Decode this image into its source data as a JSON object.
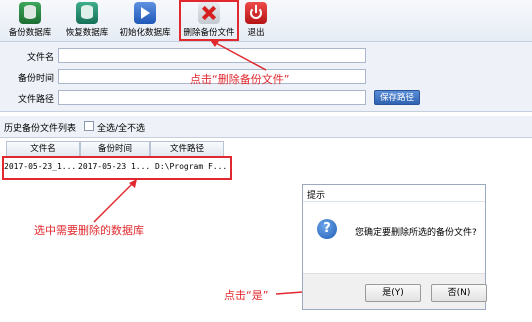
{
  "toolbar": {
    "items": [
      {
        "label": "备份数据库",
        "icon": "backup-db-icon"
      },
      {
        "label": "恢复数据库",
        "icon": "restore-db-icon"
      },
      {
        "label": "初始化数据库",
        "icon": "init-db-icon"
      },
      {
        "label": "删除备份文件",
        "icon": "delete-backup-icon"
      },
      {
        "label": "退出",
        "icon": "power-icon"
      }
    ]
  },
  "form": {
    "file_name_label": "文件名",
    "backup_time_label": "备份时间",
    "file_path_label": "文件路径",
    "save_path_button": "保存路径"
  },
  "history": {
    "title": "历史备份文件列表",
    "select_all_label": "全选/全不选",
    "columns": [
      "文件名",
      "备份时间",
      "文件路径"
    ],
    "rows": [
      {
        "name": "2017-05-23_1...",
        "time": "2017-05-23 1...",
        "path": "D:\\Program F..."
      }
    ]
  },
  "annotations": {
    "click_delete": "点击“删除备份文件”",
    "select_db": "选中需要删除的数据库",
    "click_yes": "点击“是”"
  },
  "dialog": {
    "title": "提示",
    "message": "您确定要删除所选的备份文件?",
    "yes": "是(Y)",
    "no": "否(N)"
  },
  "colors": {
    "annotation": "#e0282e",
    "accent_button": "#2f63b0"
  }
}
